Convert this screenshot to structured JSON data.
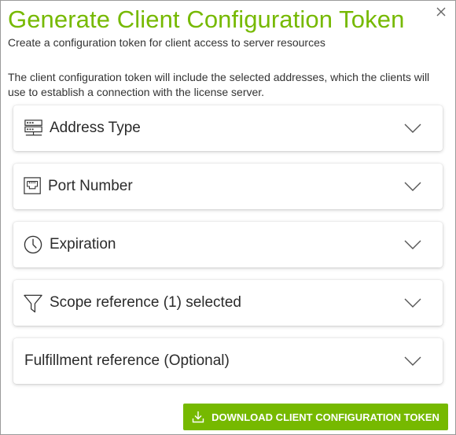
{
  "dialog": {
    "title": "Generate Client Configuration Token",
    "subtitle": "Create a configuration token for client access to server resources",
    "description": "The client configuration token will include the selected addresses, which the clients will use to establish a connection with the license server.",
    "close_icon": "close-icon"
  },
  "sections": [
    {
      "label": "Address Type",
      "icon": "server-icon",
      "expanded": false
    },
    {
      "label": "Port Number",
      "icon": "ethernet-port-icon",
      "expanded": false
    },
    {
      "label": "Expiration",
      "icon": "clock-icon",
      "expanded": false
    },
    {
      "label": "Scope reference (1) selected",
      "icon": "filter-icon",
      "expanded": false
    },
    {
      "label": "Fulfillment reference (Optional)",
      "icon": "",
      "expanded": false
    }
  ],
  "actions": {
    "download_label": "DOWNLOAD CLIENT CONFIGURATION TOKEN",
    "download_icon": "download-icon"
  },
  "colors": {
    "accent": "#76b900",
    "text": "#222222",
    "border": "#9a9a9a"
  }
}
